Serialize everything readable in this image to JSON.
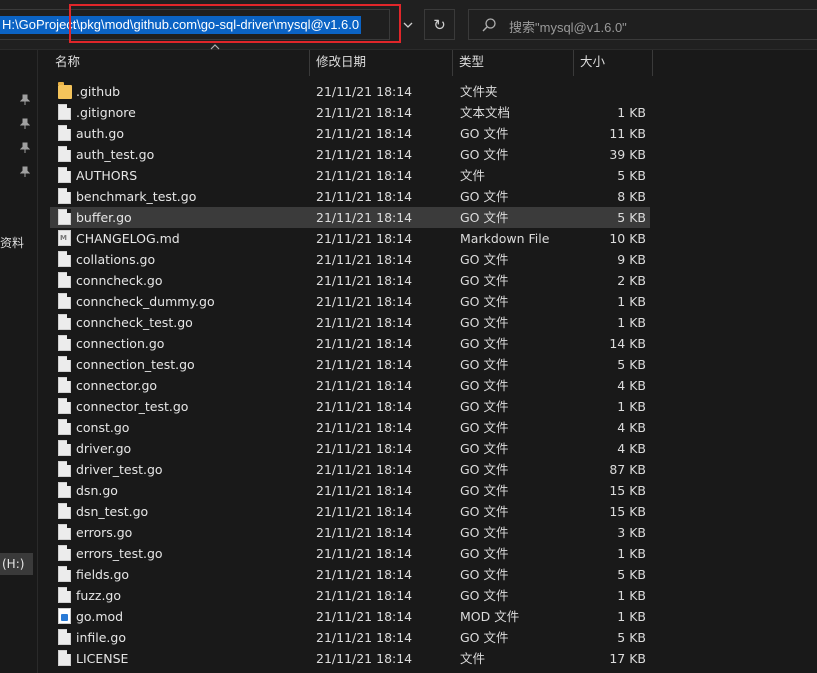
{
  "address_bar": {
    "path": "H:\\GoProject\\pkg\\mod\\github.com\\go-sql-driver\\mysql@v1.6.0"
  },
  "toolbar": {
    "dropdown_icon": "chevron-down-icon",
    "refresh_icon": "refresh-icon",
    "refresh_glyph": "↻"
  },
  "search": {
    "placeholder": "搜索\"mysql@v1.6.0\"",
    "icon": "search-icon"
  },
  "nav": {
    "partial_label": "资料",
    "drive_label": "(H:)"
  },
  "columns": {
    "name": "名称",
    "date": "修改日期",
    "type": "类型",
    "size": "大小"
  },
  "colors": {
    "selection": "#3b3b3b",
    "address_highlight": "#0b63c4",
    "annotation_box": "#e0262a",
    "folder": "#f5c45b"
  },
  "files": [
    {
      "name": ".github",
      "date": "21/11/21 18:14",
      "type": "文件夹",
      "size": "",
      "icon": "folder",
      "selected": false
    },
    {
      "name": ".gitignore",
      "date": "21/11/21 18:14",
      "type": "文本文档",
      "size": "1 KB",
      "icon": "file",
      "selected": false
    },
    {
      "name": "auth.go",
      "date": "21/11/21 18:14",
      "type": "GO 文件",
      "size": "11 KB",
      "icon": "file",
      "selected": false
    },
    {
      "name": "auth_test.go",
      "date": "21/11/21 18:14",
      "type": "GO 文件",
      "size": "39 KB",
      "icon": "file",
      "selected": false
    },
    {
      "name": "AUTHORS",
      "date": "21/11/21 18:14",
      "type": "文件",
      "size": "5 KB",
      "icon": "file",
      "selected": false
    },
    {
      "name": "benchmark_test.go",
      "date": "21/11/21 18:14",
      "type": "GO 文件",
      "size": "8 KB",
      "icon": "file",
      "selected": false
    },
    {
      "name": "buffer.go",
      "date": "21/11/21 18:14",
      "type": "GO 文件",
      "size": "5 KB",
      "icon": "file",
      "selected": true
    },
    {
      "name": "CHANGELOG.md",
      "date": "21/11/21 18:14",
      "type": "Markdown File",
      "size": "10 KB",
      "icon": "md",
      "selected": false
    },
    {
      "name": "collations.go",
      "date": "21/11/21 18:14",
      "type": "GO 文件",
      "size": "9 KB",
      "icon": "file",
      "selected": false
    },
    {
      "name": "conncheck.go",
      "date": "21/11/21 18:14",
      "type": "GO 文件",
      "size": "2 KB",
      "icon": "file",
      "selected": false
    },
    {
      "name": "conncheck_dummy.go",
      "date": "21/11/21 18:14",
      "type": "GO 文件",
      "size": "1 KB",
      "icon": "file",
      "selected": false
    },
    {
      "name": "conncheck_test.go",
      "date": "21/11/21 18:14",
      "type": "GO 文件",
      "size": "1 KB",
      "icon": "file",
      "selected": false
    },
    {
      "name": "connection.go",
      "date": "21/11/21 18:14",
      "type": "GO 文件",
      "size": "14 KB",
      "icon": "file",
      "selected": false
    },
    {
      "name": "connection_test.go",
      "date": "21/11/21 18:14",
      "type": "GO 文件",
      "size": "5 KB",
      "icon": "file",
      "selected": false
    },
    {
      "name": "connector.go",
      "date": "21/11/21 18:14",
      "type": "GO 文件",
      "size": "4 KB",
      "icon": "file",
      "selected": false
    },
    {
      "name": "connector_test.go",
      "date": "21/11/21 18:14",
      "type": "GO 文件",
      "size": "1 KB",
      "icon": "file",
      "selected": false
    },
    {
      "name": "const.go",
      "date": "21/11/21 18:14",
      "type": "GO 文件",
      "size": "4 KB",
      "icon": "file",
      "selected": false
    },
    {
      "name": "driver.go",
      "date": "21/11/21 18:14",
      "type": "GO 文件",
      "size": "4 KB",
      "icon": "file",
      "selected": false
    },
    {
      "name": "driver_test.go",
      "date": "21/11/21 18:14",
      "type": "GO 文件",
      "size": "87 KB",
      "icon": "file",
      "selected": false
    },
    {
      "name": "dsn.go",
      "date": "21/11/21 18:14",
      "type": "GO 文件",
      "size": "15 KB",
      "icon": "file",
      "selected": false
    },
    {
      "name": "dsn_test.go",
      "date": "21/11/21 18:14",
      "type": "GO 文件",
      "size": "15 KB",
      "icon": "file",
      "selected": false
    },
    {
      "name": "errors.go",
      "date": "21/11/21 18:14",
      "type": "GO 文件",
      "size": "3 KB",
      "icon": "file",
      "selected": false
    },
    {
      "name": "errors_test.go",
      "date": "21/11/21 18:14",
      "type": "GO 文件",
      "size": "1 KB",
      "icon": "file",
      "selected": false
    },
    {
      "name": "fields.go",
      "date": "21/11/21 18:14",
      "type": "GO 文件",
      "size": "5 KB",
      "icon": "file",
      "selected": false
    },
    {
      "name": "fuzz.go",
      "date": "21/11/21 18:14",
      "type": "GO 文件",
      "size": "1 KB",
      "icon": "file",
      "selected": false
    },
    {
      "name": "go.mod",
      "date": "21/11/21 18:14",
      "type": "MOD 文件",
      "size": "1 KB",
      "icon": "mod",
      "selected": false
    },
    {
      "name": "infile.go",
      "date": "21/11/21 18:14",
      "type": "GO 文件",
      "size": "5 KB",
      "icon": "file",
      "selected": false
    },
    {
      "name": "LICENSE",
      "date": "21/11/21 18:14",
      "type": "文件",
      "size": "17 KB",
      "icon": "file",
      "selected": false
    }
  ]
}
